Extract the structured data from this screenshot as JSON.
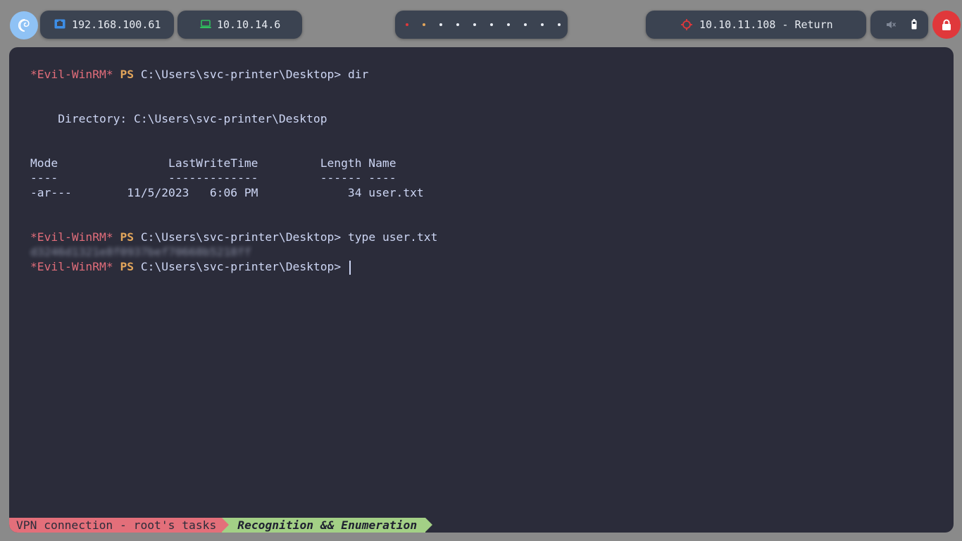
{
  "topbar": {
    "launcher_icon": "debian-icon",
    "local_ip": "192.168.100.61",
    "local_ip_icon": "ethernet-icon",
    "vpn_ip": "10.10.14.6",
    "vpn_ip_icon": "laptop-icon",
    "workspace_count": 10,
    "target_text": "10.10.11.108 - Return",
    "target_icon": "crosshair-icon",
    "mute_icon": "speaker-muted-icon",
    "battery_icon": "battery-icon",
    "lock_icon": "lock-icon",
    "colors": {
      "active_ws": "#e0383b",
      "current_ws": "#e3a65b",
      "ws": "#e8ecf2",
      "target_icon": "#e0383b",
      "lock_bg": "#e0383b"
    }
  },
  "terminal": {
    "prompt_shell": "*Evil-WinRM*",
    "prompt_ps": "PS",
    "prompt_path": "C:\\Users\\svc-printer\\Desktop>",
    "cmd1": " dir",
    "dir_line": "    Directory: C:\\Users\\svc-printer\\Desktop",
    "header": "Mode                LastWriteTime         Length Name",
    "underline": "----                -------------         ------ ----",
    "row": "-ar---        11/5/2023   6:06 PM             34 user.txt",
    "cmd2": " type user.txt",
    "flag": "d3246d1321e8f0937bef70668b5218ff",
    "cmd3": " "
  },
  "statusbar": {
    "task": "VPN connection - root's tasks",
    "phase": "Recognition && Enumeration"
  }
}
